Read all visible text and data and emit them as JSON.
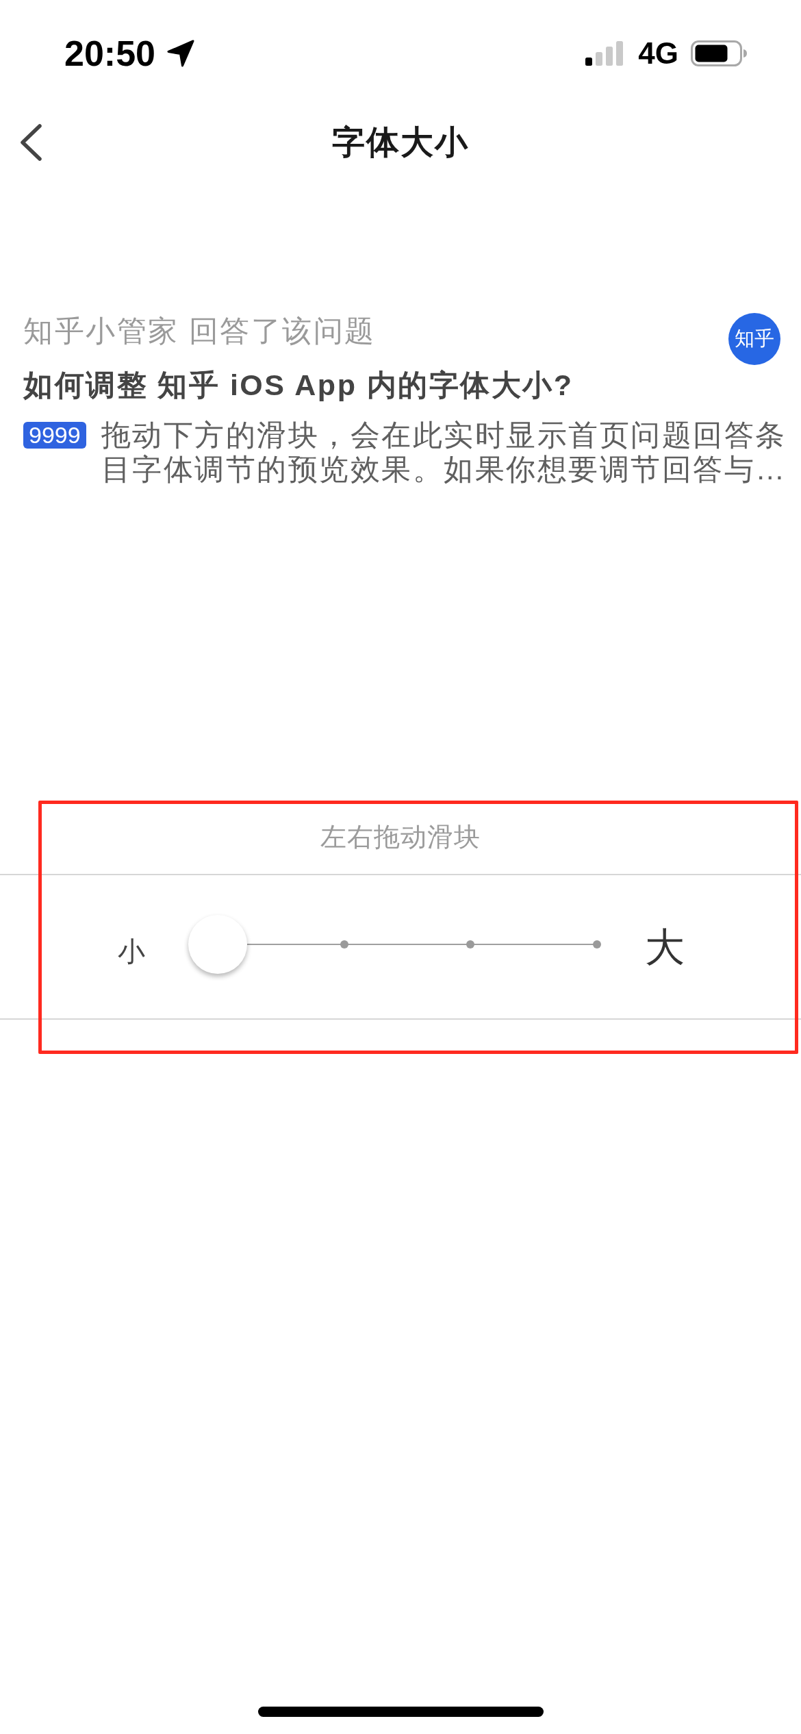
{
  "status_bar": {
    "time": "20:50",
    "network": "4G"
  },
  "nav_bar": {
    "title": "字体大小"
  },
  "preview_card": {
    "source": "知乎小管家 回答了该问题",
    "avatar_text": "知乎",
    "question": "如何调整 知乎 iOS App 内的字体大小?",
    "badge": "9999",
    "excerpt": "拖动下方的滑块，会在此实时显示首页问题回答条目字体调节的预览效果。如果你想要调节回答与…"
  },
  "font_slider": {
    "hint": "左右拖动滑块",
    "min_label": "小",
    "max_label": "大",
    "level": 0
  },
  "annotations": [
    {
      "kind": "rectangle"
    }
  ]
}
